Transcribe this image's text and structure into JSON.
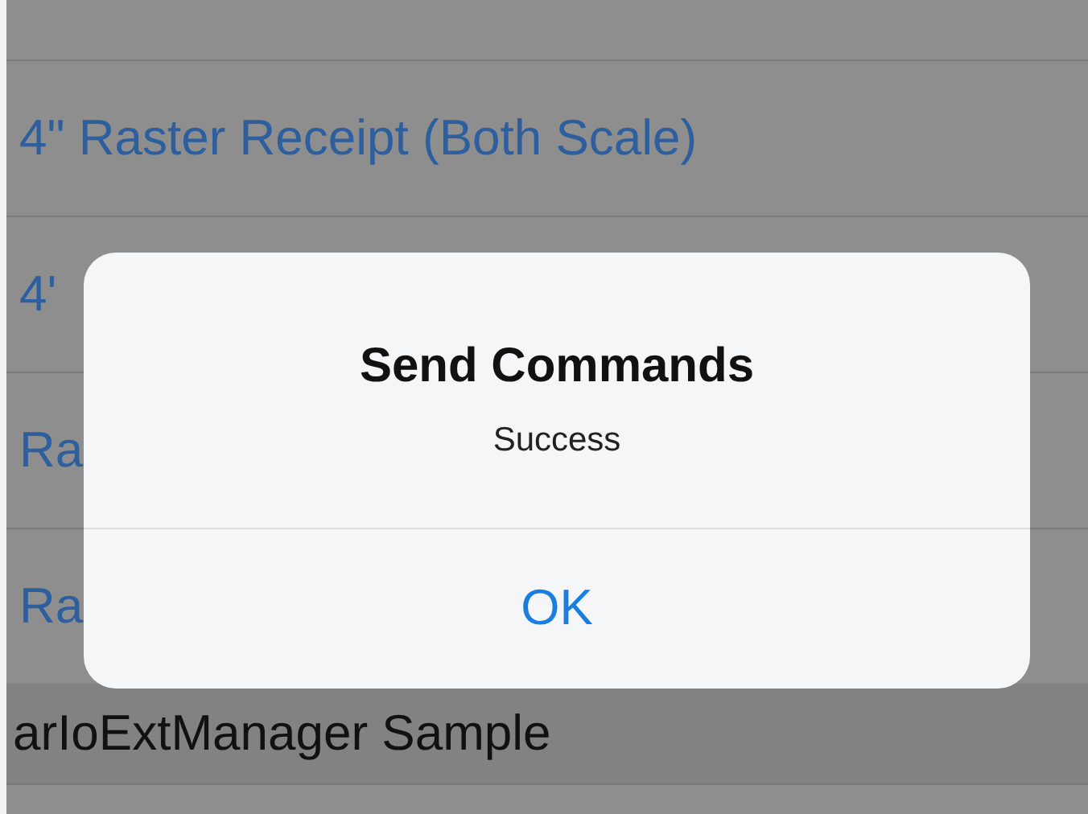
{
  "list": {
    "rows": [
      {
        "label": "4\" Raster Receipt (Both Scale)"
      },
      {
        "label": "4'"
      },
      {
        "label": "Ra"
      },
      {
        "label": "Ra"
      }
    ],
    "section_header": "arIoExtManager Sample"
  },
  "alert": {
    "title": "Send Commands",
    "message": "Success",
    "buttons": [
      {
        "label": "OK"
      }
    ]
  }
}
